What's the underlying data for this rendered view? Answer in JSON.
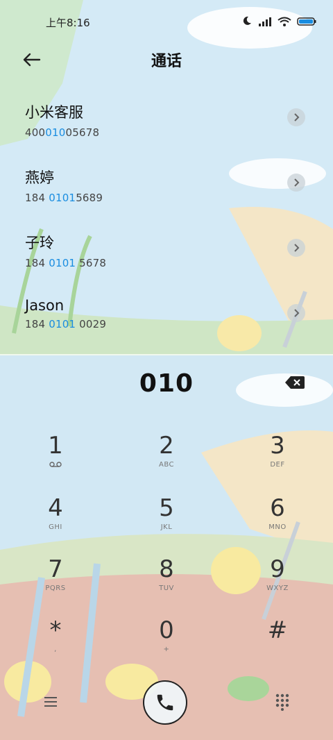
{
  "status": {
    "time": "上午8:16"
  },
  "header": {
    "title": "通话"
  },
  "contacts": [
    {
      "name": "小米客服",
      "num_pre": "400",
      "num_hl": "010",
      "num_post": "05678"
    },
    {
      "name": "燕婷",
      "num_pre": "184 ",
      "num_hl": "0101",
      "num_post": "5689"
    },
    {
      "name": "子玲",
      "num_pre": "184 ",
      "num_hl": "0101",
      "num_post": " 5678"
    },
    {
      "name": "Jason",
      "num_pre": "184 ",
      "num_hl": "0101",
      "num_post": " 0029"
    }
  ],
  "dialer": {
    "number": "010",
    "keys": [
      {
        "digit": "1",
        "letters": ""
      },
      {
        "digit": "2",
        "letters": "ABC"
      },
      {
        "digit": "3",
        "letters": "DEF"
      },
      {
        "digit": "4",
        "letters": "GHI"
      },
      {
        "digit": "5",
        "letters": "JKL"
      },
      {
        "digit": "6",
        "letters": "MNO"
      },
      {
        "digit": "7",
        "letters": "PQRS"
      },
      {
        "digit": "8",
        "letters": "TUV"
      },
      {
        "digit": "9",
        "letters": "WXYZ"
      },
      {
        "digit": "*",
        "letters": ","
      },
      {
        "digit": "0",
        "letters": "+"
      },
      {
        "digit": "#",
        "letters": ""
      }
    ]
  },
  "icons": {
    "back": "arrow-left-icon",
    "backspace": "backspace-icon",
    "call": "phone-icon",
    "menu": "menu-icon",
    "keypad": "dialpad-icon",
    "voicemail": "voicemail-icon"
  },
  "colors": {
    "highlight": "#1a8de0"
  }
}
